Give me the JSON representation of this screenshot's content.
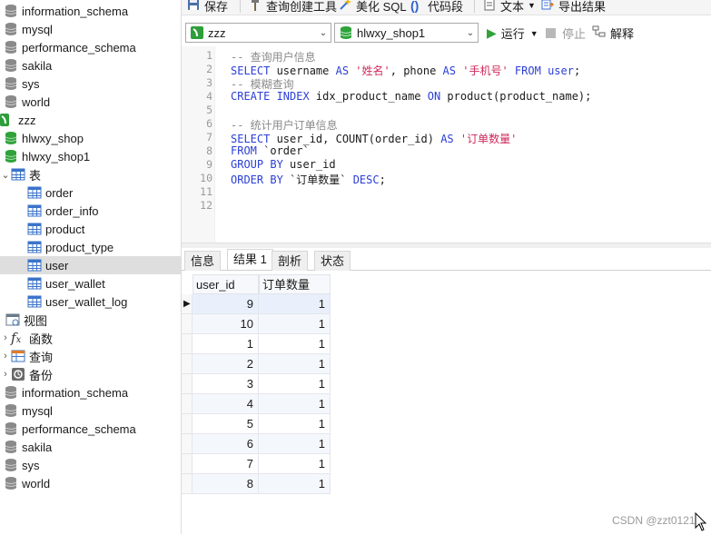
{
  "tree": {
    "top_items": [
      "information_schema",
      "mysql",
      "performance_schema",
      "sakila",
      "sys",
      "world"
    ],
    "connection": "zzz",
    "databases": [
      "hlwxy_shop",
      "hlwxy_shop1"
    ],
    "tables_folder": "表",
    "tables": [
      "order",
      "order_info",
      "product",
      "product_type",
      "user",
      "user_wallet",
      "user_wallet_log"
    ],
    "selected_table": "user",
    "folders": [
      "视图",
      "函数",
      "查询",
      "备份"
    ],
    "bottom_items": [
      "information_schema",
      "mysql",
      "performance_schema",
      "sakila",
      "sys",
      "world"
    ]
  },
  "toolbar": {
    "save": "保存",
    "query_builder": "查询创建工具",
    "beautify": "美化 SQL",
    "snippet": "代码段",
    "text": "文本",
    "export": "导出结果"
  },
  "bar2": {
    "connection": "zzz",
    "database": "hlwxy_shop1",
    "run": "运行",
    "stop": "停止",
    "explain": "解释"
  },
  "editor": {
    "line_numbers": [
      "1",
      "2",
      "3",
      "4",
      "5",
      "6",
      "7",
      "8",
      "9",
      "10",
      "11",
      "12"
    ],
    "lines": [
      [
        {
          "c": "cm",
          "t": "-- 查询用户信息"
        }
      ],
      [
        {
          "c": "kw",
          "t": "SELECT"
        },
        {
          "c": "tx",
          "t": " username "
        },
        {
          "c": "kw",
          "t": "AS"
        },
        {
          "c": "tx",
          "t": " "
        },
        {
          "c": "st",
          "t": "'姓名'"
        },
        {
          "c": "tx",
          "t": ", phone "
        },
        {
          "c": "kw",
          "t": "AS"
        },
        {
          "c": "tx",
          "t": " "
        },
        {
          "c": "st",
          "t": "'手机号'"
        },
        {
          "c": "tx",
          "t": " "
        },
        {
          "c": "kw",
          "t": "FROM"
        },
        {
          "c": "tx",
          "t": " "
        },
        {
          "c": "kw",
          "t": "user"
        },
        {
          "c": "tx",
          "t": ";"
        }
      ],
      [
        {
          "c": "cm",
          "t": "-- 模糊查询"
        }
      ],
      [
        {
          "c": "kw",
          "t": "CREATE INDEX"
        },
        {
          "c": "tx",
          "t": " idx_product_name "
        },
        {
          "c": "kw",
          "t": "ON"
        },
        {
          "c": "tx",
          "t": " product(product_name);"
        }
      ],
      [],
      [
        {
          "c": "cm",
          "t": "-- 统计用户订单信息"
        }
      ],
      [
        {
          "c": "kw",
          "t": "SELECT"
        },
        {
          "c": "tx",
          "t": " user_id, COUNT(order_id) "
        },
        {
          "c": "kw",
          "t": "AS"
        },
        {
          "c": "tx",
          "t": " "
        },
        {
          "c": "st",
          "t": "'订单数量'"
        }
      ],
      [
        {
          "c": "kw",
          "t": "FROM"
        },
        {
          "c": "tx",
          "t": " `order`"
        }
      ],
      [
        {
          "c": "kw",
          "t": "GROUP BY"
        },
        {
          "c": "tx",
          "t": " user_id"
        }
      ],
      [
        {
          "c": "kw",
          "t": "ORDER BY"
        },
        {
          "c": "tx",
          "t": " `订单数量` "
        },
        {
          "c": "kw",
          "t": "DESC"
        },
        {
          "c": "tx",
          "t": ";"
        }
      ],
      [],
      []
    ]
  },
  "result_tabs": [
    "信息",
    "结果 1",
    "剖析",
    "状态"
  ],
  "active_tab": "结果 1",
  "grid": {
    "columns": [
      "user_id",
      "订单数量"
    ],
    "rows": [
      [
        "9",
        "1"
      ],
      [
        "10",
        "1"
      ],
      [
        "1",
        "1"
      ],
      [
        "2",
        "1"
      ],
      [
        "3",
        "1"
      ],
      [
        "4",
        "1"
      ],
      [
        "5",
        "1"
      ],
      [
        "6",
        "1"
      ],
      [
        "7",
        "1"
      ],
      [
        "8",
        "1"
      ]
    ]
  },
  "watermark": "CSDN @zzt0121"
}
